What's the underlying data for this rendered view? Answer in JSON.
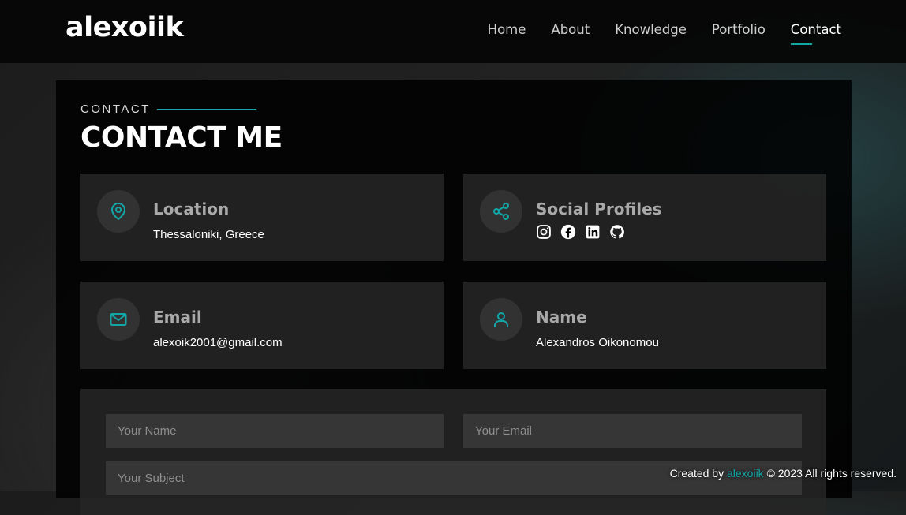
{
  "brand": "alexoiik",
  "nav": [
    "Home",
    "About",
    "Knowledge",
    "Portfolio",
    "Contact"
  ],
  "section": {
    "kicker": "CONTACT",
    "title": "CONTACT ME"
  },
  "cards": {
    "location": {
      "title": "Location",
      "value": "Thessaloniki, Greece",
      "icon": "map-pin-icon"
    },
    "social": {
      "title": "Social Profiles",
      "icon": "share-icon",
      "profiles": [
        "instagram-icon",
        "facebook-icon",
        "linkedin-icon",
        "github-icon"
      ]
    },
    "email": {
      "title": "Email",
      "value": "alexoik2001@gmail.com",
      "icon": "mail-icon"
    },
    "name": {
      "title": "Name",
      "value": "Alexandros Oikonomou",
      "icon": "user-icon"
    }
  },
  "form": {
    "name_placeholder": "Your Name",
    "email_placeholder": "Your Email",
    "subject_placeholder": "Your Subject"
  },
  "footer": {
    "prefix": "Created by",
    "author": "alexoiik",
    "copyright_symbol": "©",
    "suffix": "2023 All rights reserved."
  },
  "colors": {
    "accent": "#12a6a6",
    "background": "#000000"
  }
}
